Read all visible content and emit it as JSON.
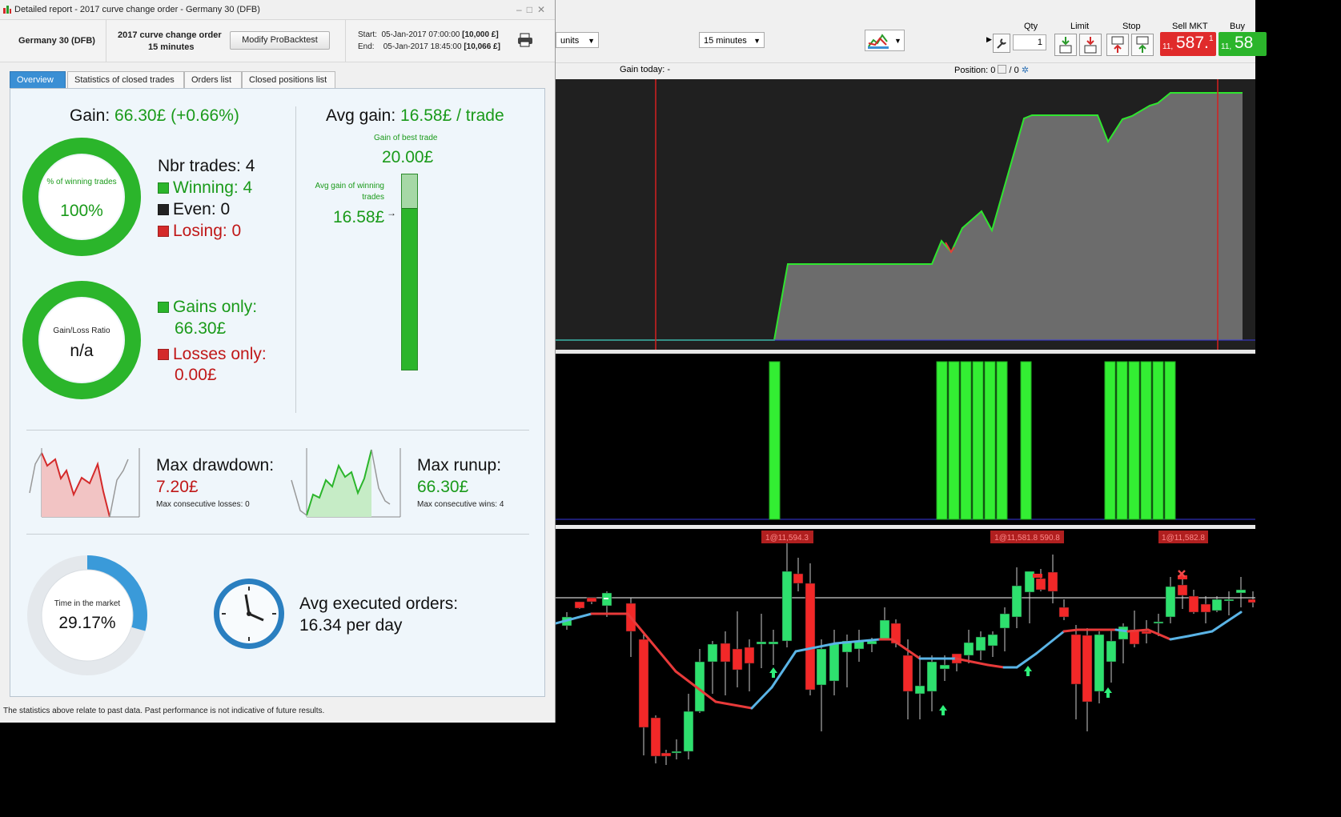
{
  "platform": {
    "units_select": "units",
    "interval_select": "15 minutes",
    "headers": {
      "qty": "Qty",
      "limit": "Limit",
      "stop": "Stop",
      "sell_mkt": "Sell MKT",
      "buy_mkt": "Buy MI"
    },
    "qty_value": "1",
    "sell_price_small": "11,",
    "sell_price_big": "587.",
    "sell_price_tail": "1",
    "buy_price_small": "11,",
    "buy_price_big": "58",
    "gain_today_label": "Gain today:",
    "gain_today_value": "-",
    "position_label": "Position:",
    "position_value": "0",
    "position_sep": "/",
    "position_value2": "0",
    "trade_labels": [
      "1@11,594.3",
      "1@11,581.8 590.8",
      "1@11,582.8"
    ],
    "colors": {
      "sell": "#e02b2b",
      "buy": "#2bb52b",
      "equity_line": "#2fe52f",
      "equity_fill": "#6c6c6c",
      "bars": "#33ee33",
      "ma_up": "#5ab4e6",
      "ma_down": "#e83a3a"
    }
  },
  "report": {
    "title": "Detailed report - 2017 curve change order - Germany 30 (DFB)",
    "instrument": "Germany 30 (DFB)",
    "system_name": "2017 curve change order",
    "timeframe": "15 minutes",
    "modify_button": "Modify ProBacktest",
    "start_label": "Start:",
    "start_date": "05-Jan-2017 07:00:00",
    "start_capital": "[10,000 £]",
    "end_label": "End:",
    "end_date": "05-Jan-2017 18:45:00",
    "end_capital": "[10,066 £]",
    "tabs": [
      "Overview",
      "Statistics of closed trades",
      "Orders list",
      "Closed positions list"
    ],
    "gain_label": "Gain:",
    "gain_value": "66.30£ (+0.66%)",
    "winning_pct_label": "% of winning trades",
    "winning_pct": "100%",
    "winning_fraction": 1.0,
    "nbr_trades": "Nbr trades: 4",
    "winning": "Winning: 4",
    "even": "Even: 0",
    "losing": "Losing: 0",
    "gl_ratio_label": "Gain/Loss Ratio",
    "gl_ratio": "n/a",
    "gains_only_label": "Gains only:",
    "gains_only_value": "66.30£",
    "losses_only_label": "Losses only:",
    "losses_only_value": "0.00£",
    "avg_gain_label": "Avg gain:",
    "avg_gain_value": "16.58£ / trade",
    "best_trade_label": "Gain of best trade",
    "best_trade_value": "20.00£",
    "avg_win_label_1": "Avg gain of winning",
    "avg_win_label_2": "trades",
    "avg_win_value": "16.58£",
    "avg_win_fraction": 0.829,
    "max_drawdown_label": "Max drawdown:",
    "max_drawdown_value": "7.20£",
    "max_consec_losses": "Max consecutive losses: 0",
    "max_runup_label": "Max runup:",
    "max_runup_value": "66.30£",
    "max_consec_wins": "Max consecutive wins: 4",
    "time_market_label": "Time in the market",
    "time_market_value": "29.17%",
    "time_market_fraction": 0.2917,
    "avg_orders_label": "Avg executed orders:",
    "avg_orders_value": "16.34 per day",
    "footer": "The statistics above relate to past data. Past performance is not indicative of future results."
  }
}
